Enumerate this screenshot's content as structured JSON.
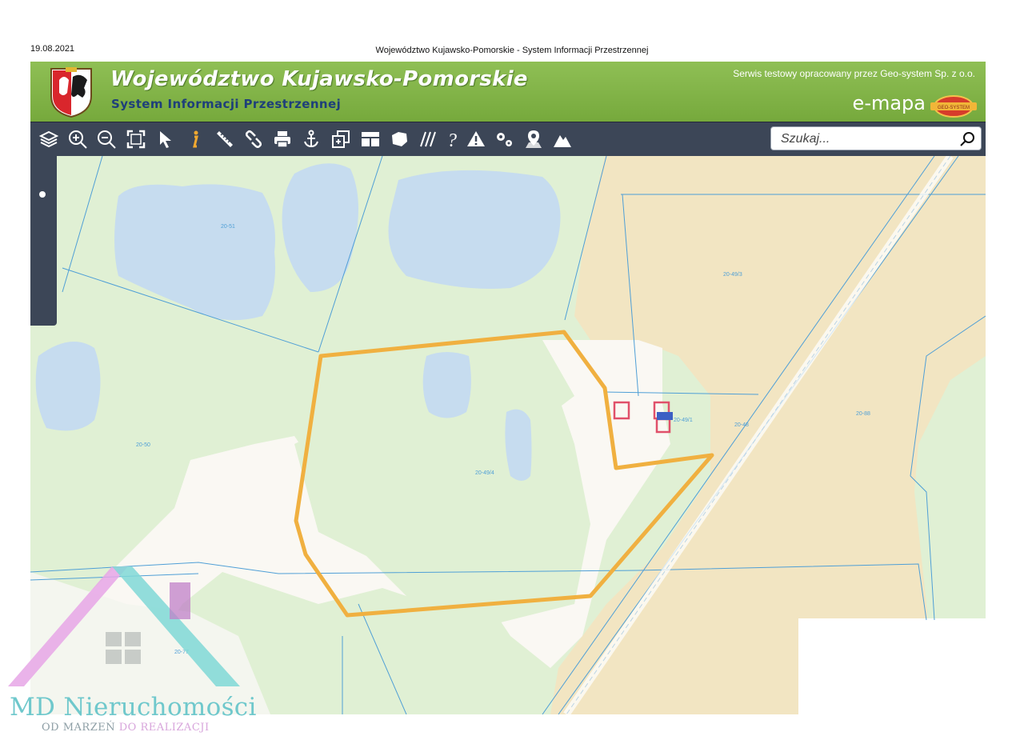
{
  "print": {
    "date": "19.08.2021",
    "title": "Województwo Kujawsko-Pomorskie - System Informacji Przestrzennej"
  },
  "banner": {
    "title": "Województwo Kujawsko-Pomorskie",
    "subtitle": "System Informacji Przestrzennej",
    "service_note": "Serwis testowy opracowany przez Geo-system Sp. z o.o.",
    "brand": "e-mapa",
    "globe_text": "GEO-SYSTEM",
    "colors": {
      "banner": "#7fb246",
      "subtitle": "#1e3f7a",
      "toolbar": "#3c4657"
    }
  },
  "toolbar": {
    "tools": [
      "layers-icon",
      "zoom-in-icon",
      "zoom-out-icon",
      "full-extent-icon",
      "select-pointer-icon",
      "info-icon",
      "measure-ruler-icon",
      "link-icon",
      "print-icon",
      "anchor-icon",
      "copy-icon",
      "layout-icon",
      "area-shape-icon",
      "hatch-icon",
      "help-icon",
      "warning-icon",
      "settings-icon",
      "map-pin-icon",
      "terrain-icon"
    ],
    "search_placeholder": "Szukaj..."
  },
  "map": {
    "parcel_labels": [
      "20-51",
      "20-49/3",
      "20-50",
      "20-49/4",
      "20-49/1",
      "20-48",
      "20-88",
      "20-77"
    ],
    "colors": {
      "meadow": "#e0f0d4",
      "water": "#c6dcef",
      "farmland": "#f2e5c2",
      "builtup": "#faf8f3",
      "parcel_line": "#4f9fd6",
      "selection": "#f0b040",
      "building": "#e0506a"
    }
  },
  "watermark": {
    "name": "MD Nieruchomości",
    "tagline_a": "OD MARZEŃ",
    "tagline_b": "DO REALIZACJI"
  }
}
